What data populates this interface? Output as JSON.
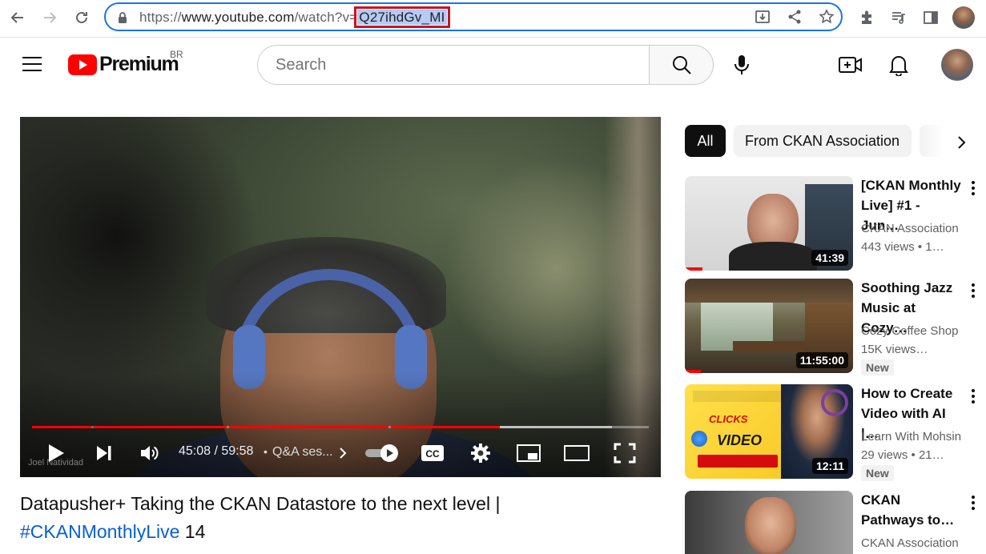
{
  "browser": {
    "url_prefix": "https://",
    "url_host": "www.youtube.com",
    "url_path": "/watch?v=",
    "url_selected": "Q27ihdGv_MI",
    "icons": [
      "back-icon",
      "forward-icon",
      "reload-icon",
      "lock-icon",
      "install-icon",
      "share-icon",
      "star-icon",
      "extensions-icon",
      "reading-list-icon",
      "side-panel-icon",
      "profile-avatar"
    ]
  },
  "header": {
    "logo_text": "Premium",
    "region": "BR",
    "search_placeholder": "Search"
  },
  "player": {
    "time": "45:08 / 59:58",
    "chapter": "Q&A ses...",
    "watermark": "Joel Natividad",
    "progress_fraction": 0.752
  },
  "video": {
    "title": "Datapusher+ Taking the CKAN Datastore to the next level |",
    "hashtag": "#CKANMonthlyLive",
    "title_suffix": " 14"
  },
  "filters": {
    "chips": [
      "All",
      "From CKAN Association"
    ],
    "active": "All"
  },
  "recommendations": [
    {
      "title": "[CKAN Monthly Live] #1 - Jun…",
      "channel": "CKAN Association",
      "meta": "443 views  • 1…",
      "duration": "41:39",
      "badge": ""
    },
    {
      "title": "Soothing Jazz Music at Cozy…",
      "channel": "Cozy Coffee Shop",
      "meta": "15K views…",
      "duration": "11:55:00",
      "badge": "New"
    },
    {
      "title": "How to Create Video with AI |…",
      "channel": "Learn With Mohsin",
      "meta": "29 views  • 21…",
      "duration": "12:11",
      "badge": "New",
      "thumb_text": "CLICKS VIDEO"
    },
    {
      "title": "CKAN Pathways to…",
      "channel": "CKAN Association",
      "meta": "",
      "duration": "",
      "badge": ""
    }
  ],
  "colors": {
    "accent": "#1a73e8",
    "yt_red": "#ff0000",
    "link_blue": "#065fd4",
    "selection_outline": "#d0111b"
  }
}
